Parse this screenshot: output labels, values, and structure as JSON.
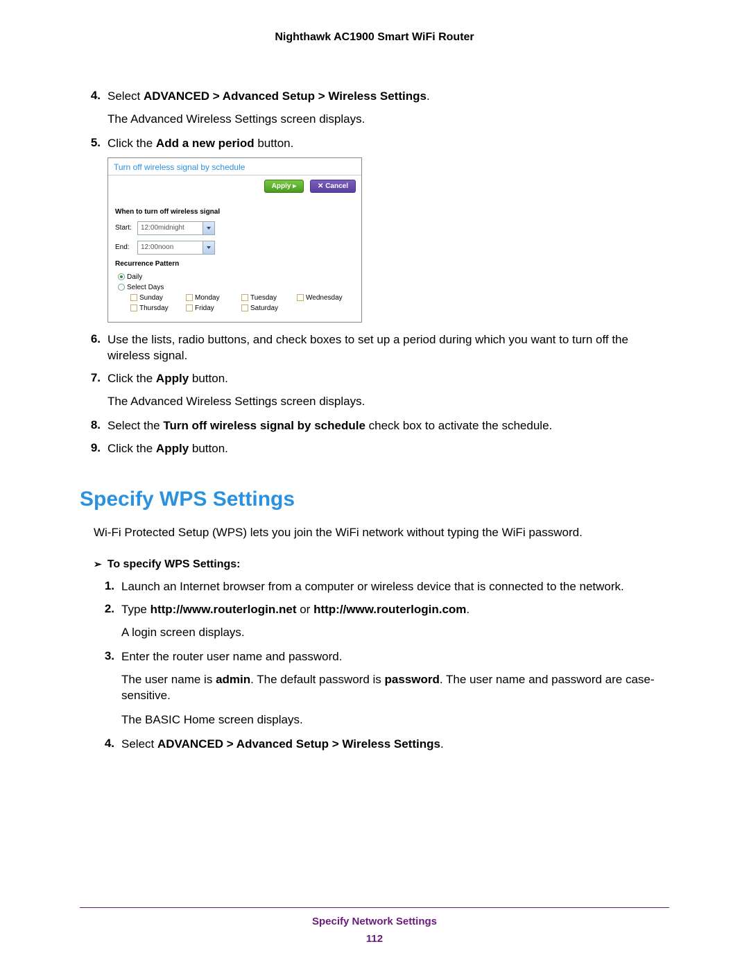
{
  "header": {
    "product": "Nighthawk AC1900 Smart WiFi Router"
  },
  "steps_a": {
    "s4": {
      "num": "4.",
      "pre": "Select ",
      "bold": "ADVANCED > Advanced Setup > Wireless Settings",
      "post": ".",
      "sub": "The Advanced Wireless Settings screen displays."
    },
    "s5": {
      "num": "5.",
      "pre": "Click the ",
      "bold": "Add a new period",
      "post": " button."
    },
    "s6": {
      "num": "6.",
      "text": "Use the lists, radio buttons, and check boxes to set up a period during which you want to turn off the wireless signal."
    },
    "s7": {
      "num": "7.",
      "pre": "Click the ",
      "bold": "Apply",
      "post": " button.",
      "sub": "The Advanced Wireless Settings screen displays."
    },
    "s8": {
      "num": "8.",
      "pre": "Select the ",
      "bold": "Turn off wireless signal by schedule",
      "post": " check box to activate the schedule."
    },
    "s9": {
      "num": "9.",
      "pre": "Click the ",
      "bold": "Apply",
      "post": " button."
    }
  },
  "sshot": {
    "title": "Turn off wireless signal by schedule",
    "apply": "Apply",
    "cancel": "Cancel",
    "when_head": "When to turn off wireless signal",
    "start_label": "Start:",
    "start_value": "12:00midnight",
    "end_label": "End:",
    "end_value": "12:00noon",
    "recur_head": "Recurrence Pattern",
    "daily": "Daily",
    "select_days": "Select Days",
    "days": [
      "Sunday",
      "Monday",
      "Tuesday",
      "Wednesday",
      "Thursday",
      "Friday",
      "Saturday"
    ]
  },
  "section": {
    "heading": "Specify WPS Settings",
    "intro": "Wi-Fi Protected Setup (WPS) lets you join the WiFi network without typing the WiFi password.",
    "task": "To specify WPS Settings:",
    "arrow": "➢"
  },
  "steps_b": {
    "s1": {
      "num": "1.",
      "text": "Launch an Internet browser from a computer or wireless device that is connected to the network."
    },
    "s2": {
      "num": "2.",
      "pre": "Type ",
      "bold": "http://www.routerlogin.net",
      "mid": " or ",
      "bold2": "http://www.routerlogin.com",
      "post": ".",
      "sub": "A login screen displays."
    },
    "s3": {
      "num": "3.",
      "text": "Enter the router user name and password.",
      "sub_parts": {
        "p1": "The user name is ",
        "b1": "admin",
        "p2": ". The default password is ",
        "b2": "password",
        "p3": ". The user name and password are case-sensitive."
      },
      "sub2": "The BASIC Home screen displays."
    },
    "s4": {
      "num": "4.",
      "pre": "Select ",
      "bold": "ADVANCED > Advanced Setup > Wireless Settings",
      "post": "."
    }
  },
  "footer": {
    "section": "Specify Network Settings",
    "page": "112"
  }
}
